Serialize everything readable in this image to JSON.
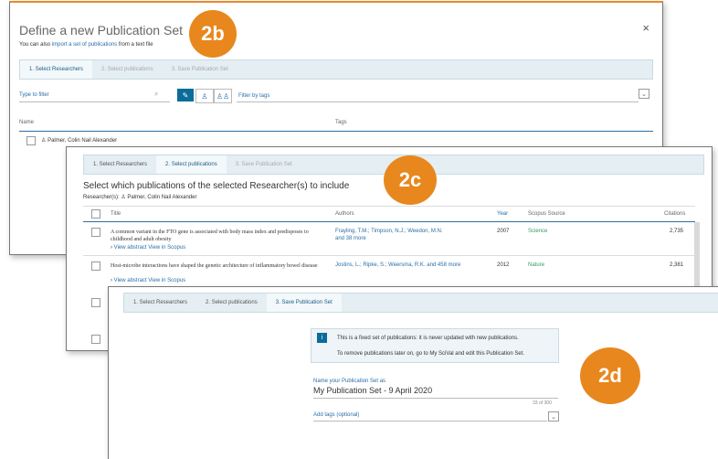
{
  "badges": {
    "b": "2b",
    "c": "2c",
    "d": "2d"
  },
  "panel_b": {
    "title": "Define a new Publication Set",
    "import_prefix": "You can also",
    "import_link": "import a set of publications",
    "import_suffix": "from a text file",
    "close": "×",
    "tabs": [
      "1. Select Researchers",
      "2. Select publications",
      "3. Save Publication Set"
    ],
    "filter_placeholder": "Type to filter",
    "filter_by_tags": "Filter by tags",
    "columns": {
      "name": "Name",
      "tags": "Tags"
    },
    "row_name": "Palmer, Colin Nail Alexander"
  },
  "panel_c": {
    "tabs": [
      "1. Select Researchers",
      "2. Select publications",
      "3. Save Publication Set"
    ],
    "heading": "Select which publications of the selected Researcher(s) to include",
    "researchers_label": "Researcher(s):",
    "researcher_name": "Palmer, Colin Nail Alexander",
    "columns": {
      "title": "Title",
      "authors": "Authors",
      "year": "Year",
      "source": "Scopus Source",
      "citations": "Citations"
    },
    "rows": [
      {
        "title": "A common variant in the FTO gene is associated with body mass index and predisposes to childhood and adult obesity",
        "authors": "Frayling, T.M.; Timpson, N.J.; Weedon, M.N.",
        "more": "and 38 more",
        "year": "2007",
        "source": "Science",
        "citations": "2,735",
        "abstract": "View abstract",
        "scopus": "View in Scopus"
      },
      {
        "title": "Host-microbe interactions have shaped the genetic architecture of inflammatory bowel disease",
        "authors": "Jostins, L.; Ripke, S.; Weersma, R.K. and 458 more",
        "more": "",
        "year": "2012",
        "source": "Nature",
        "citations": "2,381",
        "abstract": "View abstract",
        "scopus": "View in Scopus"
      }
    ]
  },
  "panel_d": {
    "tabs": [
      "1. Select Researchers",
      "2. Select publications",
      "3. Save Publication Set"
    ],
    "info_line1": "This is a fixed set of publications: it is never updated with new publications.",
    "info_line2": "To remove publications later on, go to My SciVal and edit this Publication Set.",
    "name_label": "Name your Publication Set as",
    "name_value": "My Publication Set - 9 April 2020",
    "char_count": "33 of 300",
    "add_tags": "Add tags (optional)"
  },
  "colors": {
    "accent": "#e8871e",
    "primary": "#0b6c9a",
    "link": "#2a6fa8",
    "green": "#2f9e5a"
  }
}
